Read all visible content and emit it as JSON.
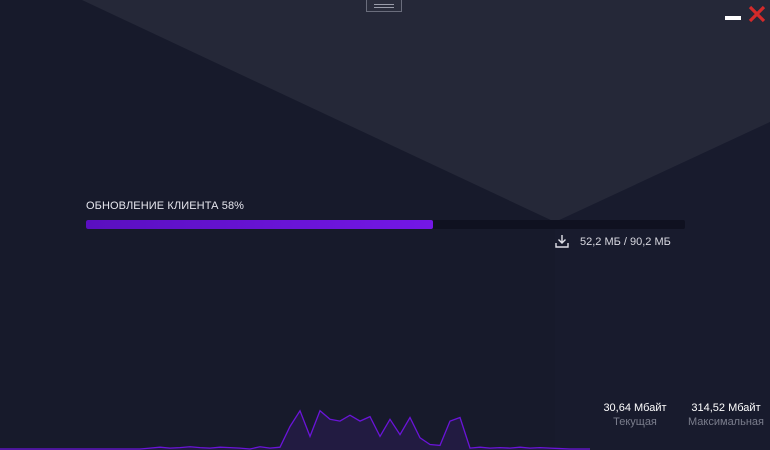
{
  "update": {
    "status_label": "ОБНОВЛЕНИЕ КЛИЕНТА 58%",
    "progress": 0.58,
    "size_text": "52,2 МБ / 90,2 МБ"
  },
  "speed": {
    "current_value": "30,64 Мбайт",
    "current_caption": "Текущая",
    "max_value": "314,52 Мбайт",
    "max_caption": "Максимальная"
  },
  "icons": {
    "download": "download-icon",
    "minimize": "minimize-icon",
    "close": "close-icon"
  },
  "colors": {
    "accent": "#6a14d8",
    "close": "#d42a2a",
    "background": "#171a2b"
  },
  "speed_graph": [
    0,
    0,
    0,
    0,
    0,
    0,
    0,
    0,
    0,
    0,
    0,
    0,
    0,
    0,
    0,
    0.02,
    0.04,
    0.02,
    0.03,
    0.05,
    0.03,
    0.02,
    0.04,
    0.03,
    0.02,
    0,
    0.05,
    0.02,
    0.04,
    0.5,
    0.85,
    0.28,
    0.85,
    0.66,
    0.62,
    0.75,
    0.62,
    0.72,
    0.28,
    0.66,
    0.32,
    0.7,
    0.25,
    0.1,
    0.08,
    0.62,
    0.7,
    0.02,
    0.04,
    0.02,
    0.03,
    0.02,
    0.04,
    0.02,
    0.03,
    0.02,
    0.01,
    0,
    0,
    0
  ]
}
